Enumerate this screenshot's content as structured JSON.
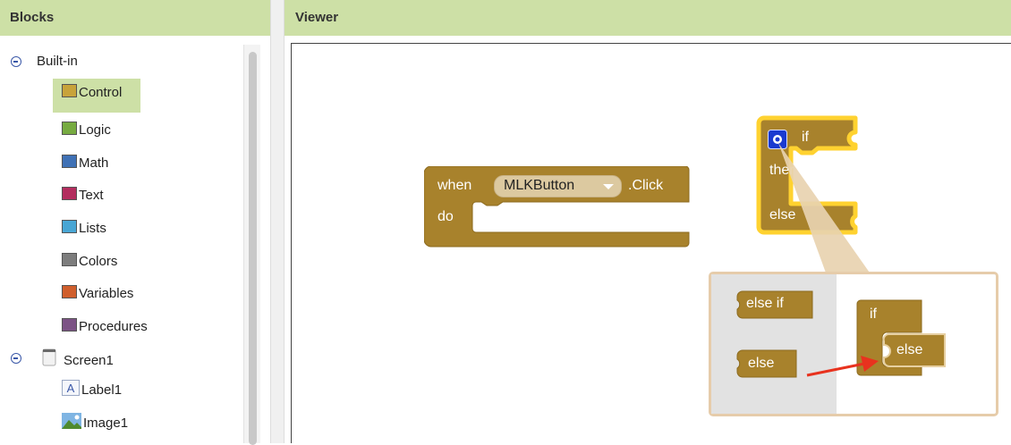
{
  "blocks_panel": {
    "title": "Blocks",
    "builtin": {
      "label": "Built-in",
      "items": [
        {
          "label": "Control",
          "color": "#c8a33a",
          "selected": true
        },
        {
          "label": "Logic",
          "color": "#77ab41"
        },
        {
          "label": "Math",
          "color": "#3f71b5"
        },
        {
          "label": "Text",
          "color": "#b32d5e"
        },
        {
          "label": "Lists",
          "color": "#49a6d4"
        },
        {
          "label": "Colors",
          "color": "#7d7d7d"
        },
        {
          "label": "Variables",
          "color": "#d05f2d"
        },
        {
          "label": "Procedures",
          "color": "#7c5385"
        }
      ]
    },
    "screen": {
      "label": "Screen1",
      "components": [
        {
          "label": "Label1",
          "icon": "label-icon"
        },
        {
          "label": "Image1",
          "icon": "image-icon"
        }
      ]
    }
  },
  "viewer": {
    "title": "Viewer",
    "event_block": {
      "when": "when",
      "component": "MLKButton",
      "event": ".Click",
      "do": "do",
      "color": "#a8822c"
    },
    "if_block": {
      "if": "if",
      "then": "then",
      "else": "else",
      "mutator_icon": "gear-icon",
      "highlight": "#ffd230"
    },
    "mutator": {
      "palette": {
        "else_if": "else if",
        "else": "else"
      },
      "workspace": {
        "if": "if",
        "else": "else"
      },
      "arrow_color": "#e8321e"
    }
  }
}
